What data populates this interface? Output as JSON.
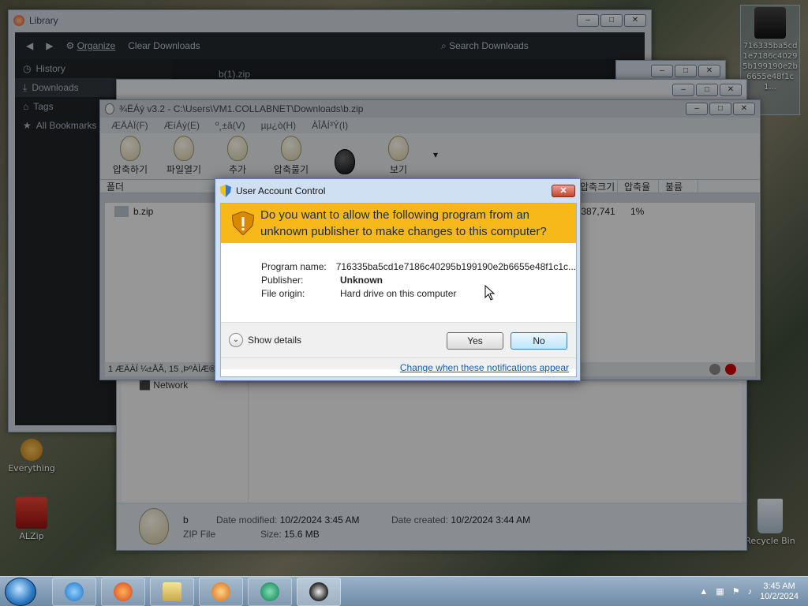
{
  "desktop": {
    "icons": [
      {
        "label": "Everything"
      },
      {
        "label": "ALZip"
      },
      {
        "label": "Recycle Bin"
      }
    ],
    "shortcut_label": "716335ba5cd1e7186c40295b199190e2b6655e48f1c1..."
  },
  "library": {
    "title": "Library",
    "organize": "Organize",
    "clear": "Clear Downloads",
    "search_placeholder": "Search Downloads",
    "sidebar": [
      "History",
      "Downloads",
      "Tags",
      "All Bookmarks"
    ],
    "download_item": "b(1).zip"
  },
  "archiver": {
    "title": "¾ËÁý v3.2 - C:\\Users\\VM1.COLLABNET\\Downloads\\b.zip",
    "menu": [
      "ÆÄÀÏ(F)",
      "ÆíÁý(E)",
      "º¸±â(V)",
      "µµ¿ò(H)",
      "ÀÎÅÍ³Ý(I)"
    ],
    "tools": [
      "압축하기",
      "파일열기",
      "추가",
      "압축풀기",
      "",
      "보기"
    ],
    "columns": [
      "폴더",
      "압축크기",
      "압축율",
      "불륨"
    ],
    "file": "b.zip",
    "size": ",387,741",
    "ratio": "1%",
    "status": "1 ÆÄÀÏ ¼±ÅÃ, 15 ,ÞºÀÌÆ®"
  },
  "explorer": {
    "network": "Network",
    "details": {
      "name": "b",
      "type": "ZIP File",
      "modified_label": "Date modified:",
      "modified": "10/2/2024 3:45 AM",
      "created_label": "Date created:",
      "created": "10/2/2024 3:44 AM",
      "size_label": "Size:",
      "size": "15.6 MB"
    }
  },
  "uac": {
    "title": "User Account Control",
    "question": "Do you want to allow the following program from an unknown publisher to make changes to this computer?",
    "program_label": "Program name:",
    "program_value": "716335ba5cd1e7186c40295b199190e2b6655e48f1c1c...",
    "publisher_label": "Publisher:",
    "publisher_value": "Unknown",
    "origin_label": "File origin:",
    "origin_value": "Hard drive on this computer",
    "show_details": "Show details",
    "yes": "Yes",
    "no": "No",
    "link": "Change when these notifications appear",
    "colors": {
      "banner": "#f7b819",
      "link": "#1a5ea6"
    }
  },
  "taskbar": {
    "apps": [
      "ie-icon",
      "firefox-icon",
      "explorer-icon",
      "media-player-icon",
      "browser-icon",
      "alzip-icon"
    ],
    "time": "3:45 AM",
    "date": "10/2/2024"
  }
}
